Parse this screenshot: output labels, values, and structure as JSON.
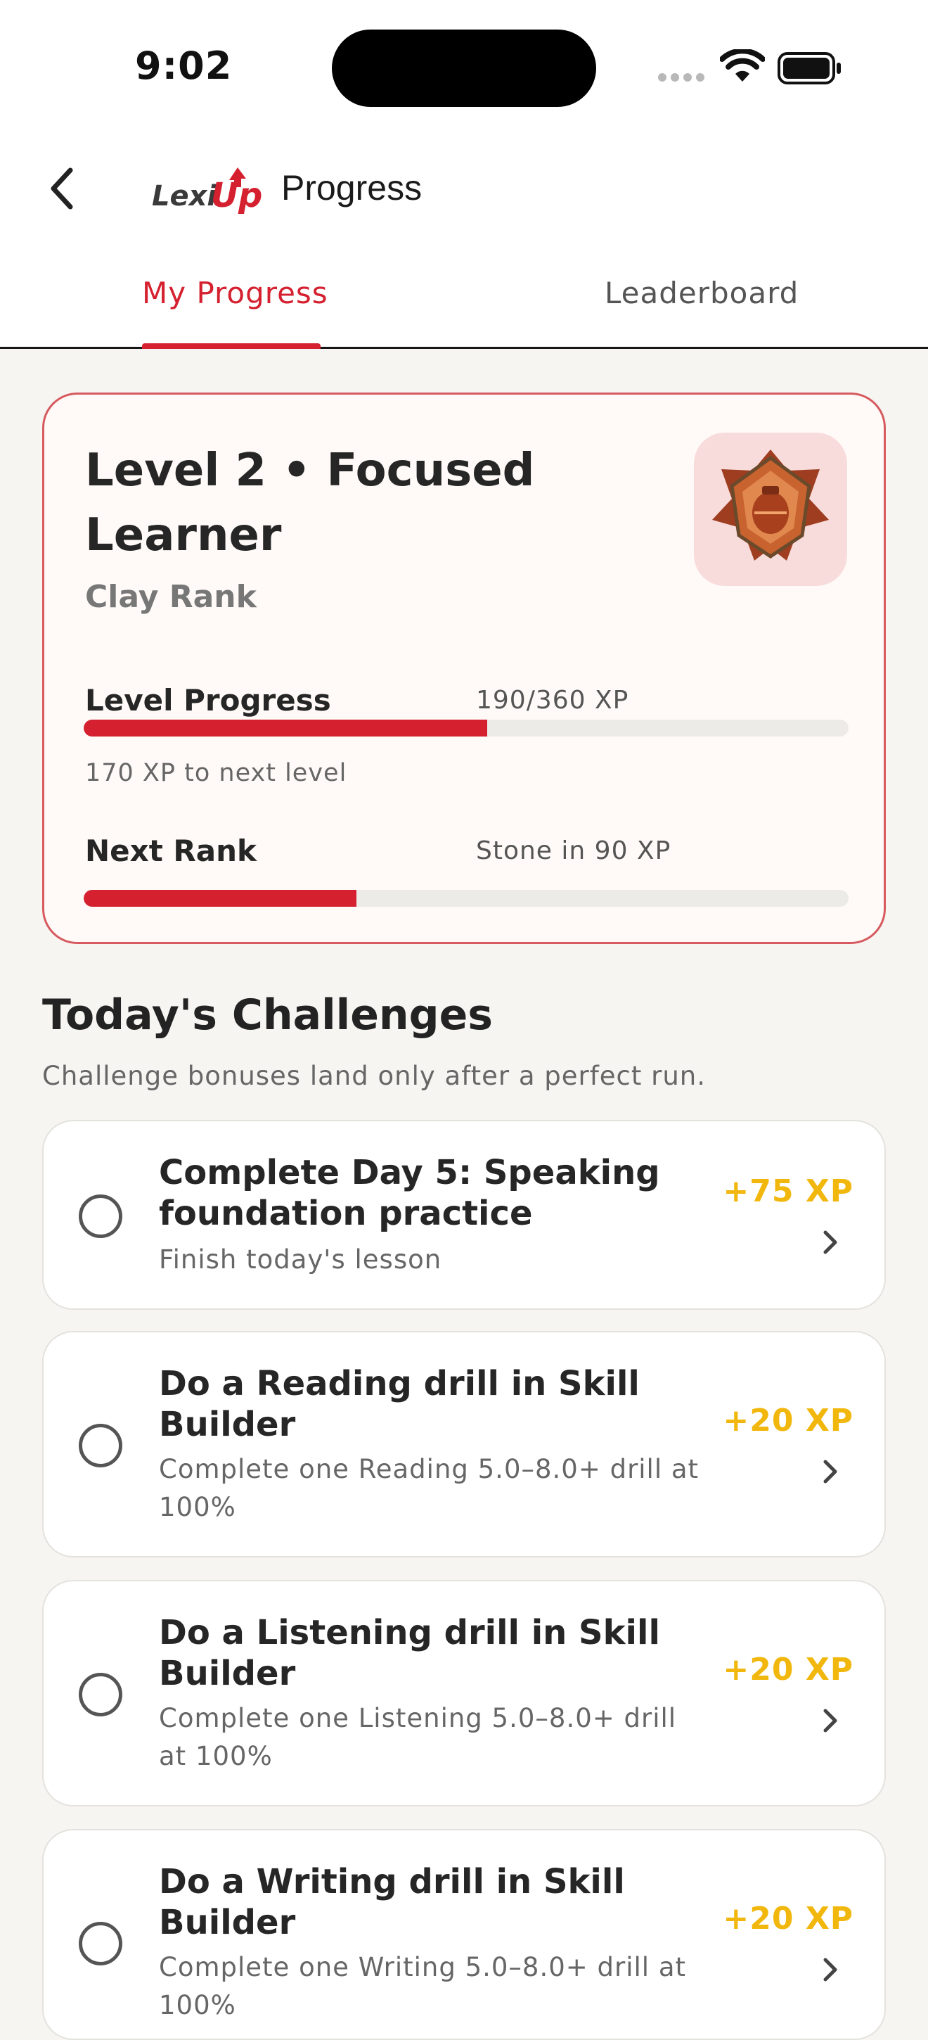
{
  "status": {
    "time": "9:02"
  },
  "header": {
    "title": "Progress",
    "logo_text": "LexiUp"
  },
  "tabs": [
    {
      "label": "My Progress",
      "active": true
    },
    {
      "label": "Leaderboard",
      "active": false
    }
  ],
  "level_card": {
    "title": "Level 2 • Focused Learner",
    "rank": "Clay Rank",
    "level_progress": {
      "label": "Level Progress",
      "value": "190/360 XP",
      "fraction": 0.528,
      "note": "170 XP to next level"
    },
    "next_rank": {
      "label": "Next Rank",
      "value": "Stone in 90 XP",
      "fraction": 0.357
    }
  },
  "challenges_section": {
    "title": "Today's Challenges",
    "subtitle": "Challenge bonuses land only after a perfect run."
  },
  "challenges": [
    {
      "title": "Complete Day 5: Speaking foundation practice",
      "desc": "Finish today's lesson",
      "xp": "+75 XP"
    },
    {
      "title": "Do a Reading drill in Skill Builder",
      "desc": "Complete one Reading 5.0–8.0+ drill at 100%",
      "xp": "+20 XP"
    },
    {
      "title": "Do a Listening drill in Skill Builder",
      "desc": "Complete one Listening 5.0–8.0+ drill at 100%",
      "xp": "+20 XP"
    },
    {
      "title": "Do a Writing drill in Skill Builder",
      "desc": "Complete one Writing 5.0–8.0+ drill at 100%",
      "xp": "+20 XP"
    }
  ],
  "colors": {
    "accent": "#d4202f",
    "xp": "#f1b70d",
    "card_border": "#d65a5f",
    "background": "#f6f5f2"
  },
  "icons": [
    "back-chevron-icon",
    "lexiup-logo",
    "clay-rank-badge-icon",
    "radio-unchecked-icon",
    "chevron-right-icon",
    "wifi-icon",
    "battery-icon",
    "cellular-signal-icon"
  ]
}
